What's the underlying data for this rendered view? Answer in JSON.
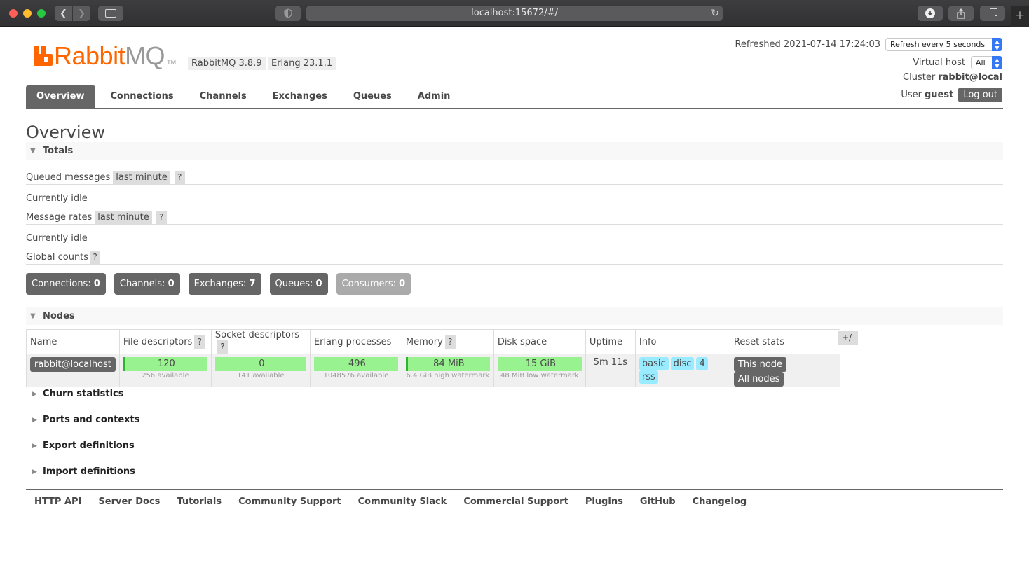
{
  "browser": {
    "url": "localhost:15672/#/"
  },
  "header": {
    "logo_main": "Rabbit",
    "logo_accent": "MQ",
    "logo_tm": "TM",
    "rabbitmq_version": "RabbitMQ 3.8.9",
    "erlang_version": "Erlang 23.1.1",
    "refreshed_label": "Refreshed 2021-07-14 17:24:03",
    "refresh_interval": "Refresh every 5 seconds",
    "vhost_label": "Virtual host",
    "vhost_value": "All",
    "cluster_label": "Cluster",
    "cluster_value": "rabbit@local",
    "user_label": "User",
    "user_value": "guest",
    "logout_label": "Log out"
  },
  "tabs": [
    {
      "label": "Overview",
      "active": true
    },
    {
      "label": "Connections"
    },
    {
      "label": "Channels"
    },
    {
      "label": "Exchanges"
    },
    {
      "label": "Queues"
    },
    {
      "label": "Admin"
    }
  ],
  "main": {
    "title": "Overview",
    "totals_label": "Totals",
    "queued_label": "Queued messages",
    "queued_period": "last minute",
    "queued_status": "Currently idle",
    "rates_label": "Message rates",
    "rates_period": "last minute",
    "rates_status": "Currently idle",
    "global_label": "Global counts",
    "help": "?",
    "counts": [
      {
        "label": "Connections:",
        "value": "0"
      },
      {
        "label": "Channels:",
        "value": "0"
      },
      {
        "label": "Exchanges:",
        "value": "7"
      },
      {
        "label": "Queues:",
        "value": "0"
      },
      {
        "label": "Consumers:",
        "value": "0"
      }
    ],
    "nodes_label": "Nodes",
    "plusminus": "+/-",
    "columns": [
      "Name",
      "File descriptors",
      "Socket descriptors",
      "Erlang processes",
      "Memory",
      "Disk space",
      "Uptime",
      "Info",
      "Reset stats"
    ],
    "node": {
      "name": "rabbit@localhost",
      "file_descriptors": "120",
      "file_descriptors_sub": "256 available",
      "socket_descriptors": "0",
      "socket_descriptors_sub": "141 available",
      "erlang_processes": "496",
      "erlang_processes_sub": "1048576 available",
      "memory": "84 MiB",
      "memory_sub": "6.4 GiB high watermark",
      "disk_space": "15 GiB",
      "disk_space_sub": "48 MiB low watermark",
      "uptime": "5m 11s",
      "info": [
        "basic",
        "disc",
        "4",
        "rss"
      ],
      "reset_this": "This node",
      "reset_all": "All nodes"
    },
    "collapsed_sections": [
      "Churn statistics",
      "Ports and contexts",
      "Export definitions",
      "Import definitions"
    ]
  },
  "footer": {
    "links": [
      "HTTP API",
      "Server Docs",
      "Tutorials",
      "Community Support",
      "Community Slack",
      "Commercial Support",
      "Plugins",
      "GitHub",
      "Changelog"
    ]
  },
  "colors": {
    "brand_orange": "#ff6600",
    "tab_active": "#666666",
    "bar_green": "#98f28f",
    "info_blue": "#99ebff"
  }
}
